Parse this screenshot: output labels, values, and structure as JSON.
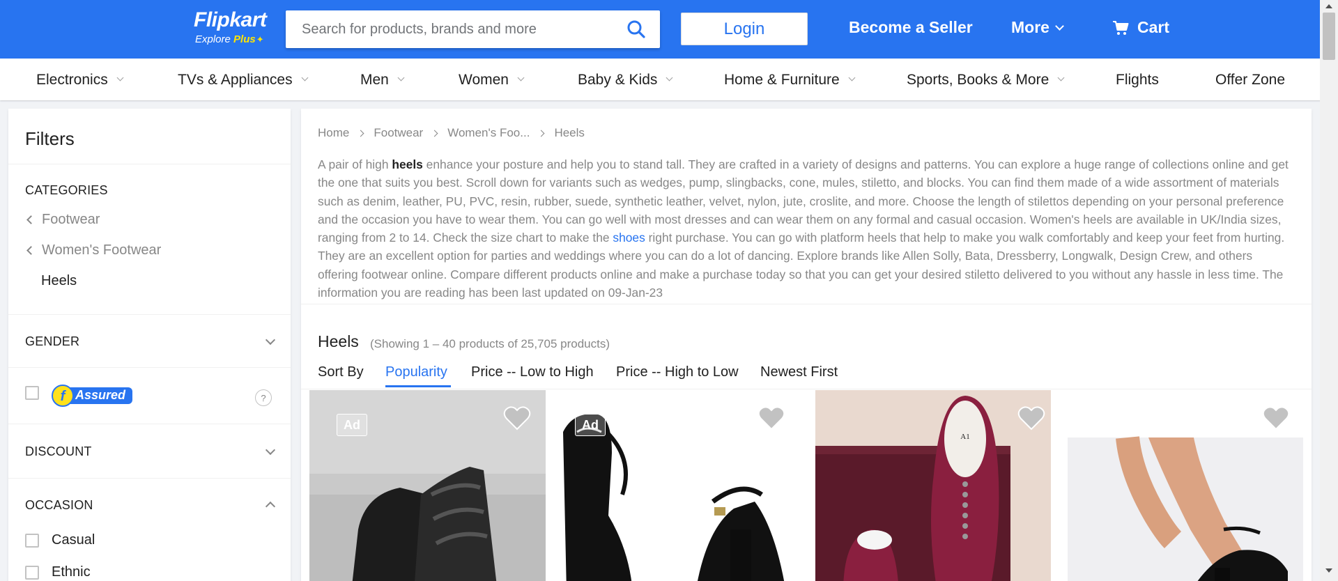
{
  "header": {
    "logo_brand": "Flipkart",
    "logo_sub_explore": "Explore",
    "logo_sub_plus": "Plus",
    "search_placeholder": "Search for products, brands and more",
    "login_label": "Login",
    "seller_label": "Become a Seller",
    "more_label": "More",
    "cart_label": "Cart",
    "brand_color": "#2874f0"
  },
  "categories": [
    {
      "label": "Electronics",
      "has_dropdown": true
    },
    {
      "label": "TVs & Appliances",
      "has_dropdown": true
    },
    {
      "label": "Men",
      "has_dropdown": true
    },
    {
      "label": "Women",
      "has_dropdown": true
    },
    {
      "label": "Baby & Kids",
      "has_dropdown": true
    },
    {
      "label": "Home & Furniture",
      "has_dropdown": true
    },
    {
      "label": "Sports, Books & More",
      "has_dropdown": true
    },
    {
      "label": "Flights",
      "has_dropdown": false
    },
    {
      "label": "Offer Zone",
      "has_dropdown": false
    }
  ],
  "filters": {
    "title": "Filters",
    "categories_title": "CATEGORIES",
    "category_path": [
      "Footwear",
      "Women's Footwear"
    ],
    "category_active": "Heels",
    "gender_title": "GENDER",
    "assured_label": "Assured",
    "help_symbol": "?",
    "discount_title": "DISCOUNT",
    "occasion_title": "OCCASION",
    "occasion_options": [
      "Casual",
      "Ethnic"
    ]
  },
  "breadcrumb": [
    "Home",
    "Footwear",
    "Women's Foo...",
    "Heels"
  ],
  "description": {
    "p1": "A pair of high ",
    "bold": "heels",
    "p2": " enhance your posture and help you to stand tall. They are crafted in a variety of designs and patterns. You can explore a huge range of collections online and get the one that suits you best. Scroll down for variants such as wedges, pump, slingbacks, cone, mules, stiletto, and blocks. You can find them made of a wide assortment of materials such as denim, leather, PU, PVC, resin, rubber, suede, synthetic leather, velvet, nylon, jute, croslite, and more. Choose the length of stilettos depending on your personal preference and the occasion you have to wear them. You can go well with most dresses and can wear them on any formal and casual occasion. Women's heels are available in UK/India sizes, ranging from 2 to 14. Check the size chart to make the ",
    "link": "shoes",
    "p3": " right purchase. You can go with platform heels that help to make you walk comfortably and keep your feet from hurting. They are an excellent option for parties and weddings where you can do a lot of dancing. Explore brands like Allen Solly, Bata, Dressberry, Longwalk, Design Crew, and others offering footwear online. Compare different products online and make a purchase today so that you can get your desired stiletto delivered to you without any hassle in less time. The information you are reading has been last updated on 09-Jan-23"
  },
  "results": {
    "title": "Heels",
    "count_text": "(Showing 1 – 40 products of 25,705 products)"
  },
  "sort": {
    "label": "Sort By",
    "options": [
      "Popularity",
      "Price -- Low to High",
      "Price -- High to Low",
      "Newest First"
    ],
    "active": "Popularity"
  },
  "products": [
    {
      "ad": true,
      "ad_label": "Ad",
      "image": "black-platform-strappy-sandal"
    },
    {
      "ad": true,
      "ad_label": "Ad",
      "image": "black-patent-block-heel-ankle-strap"
    },
    {
      "ad": false,
      "ad_label": "",
      "image": "maroon-embellished-heel-sandal"
    },
    {
      "ad": false,
      "ad_label": "",
      "image": "black-suede-block-heel-ankle-strap"
    }
  ]
}
